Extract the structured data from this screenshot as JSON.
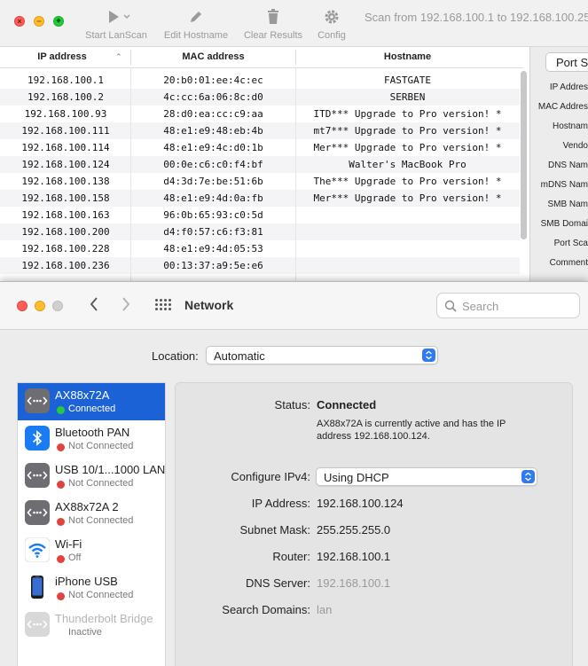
{
  "lanscan": {
    "toolbar": {
      "start_label": "Start LanScan",
      "edit_label": "Edit Hostname",
      "clear_label": "Clear Results",
      "config_label": "Config"
    },
    "title": "Scan from 192.168.100.1 to 192.168.100.25",
    "columns": {
      "ip": "IP address",
      "mac": "MAC address",
      "host": "Hostname"
    },
    "rows": [
      {
        "ip": "192.168.100.1",
        "mac": "20:b0:01:ee:4c:ec",
        "host": "FASTGATE"
      },
      {
        "ip": "192.168.100.2",
        "mac": "4c:cc:6a:06:8c:d0",
        "host": "SERBEN"
      },
      {
        "ip": "192.168.100.93",
        "mac": "28:d0:ea:cc:c9:aa",
        "host": "ITD*** Upgrade to Pro version! *"
      },
      {
        "ip": "192.168.100.111",
        "mac": "48:e1:e9:48:eb:4b",
        "host": "mt7*** Upgrade to Pro version! *"
      },
      {
        "ip": "192.168.100.114",
        "mac": "48:e1:e9:4c:d0:1b",
        "host": "Mer*** Upgrade to Pro version! *"
      },
      {
        "ip": "192.168.100.124",
        "mac": "00:0e:c6:c0:f4:bf",
        "host": "Walter's MacBook Pro"
      },
      {
        "ip": "192.168.100.138",
        "mac": "d4:3d:7e:be:51:6b",
        "host": "The*** Upgrade to Pro version! *"
      },
      {
        "ip": "192.168.100.158",
        "mac": "48:e1:e9:4d:0a:fb",
        "host": "Mer*** Upgrade to Pro version! *"
      },
      {
        "ip": "192.168.100.163",
        "mac": "96:0b:65:93:c0:5d",
        "host": ""
      },
      {
        "ip": "192.168.100.200",
        "mac": "d4:f0:57:c6:f3:81",
        "host": ""
      },
      {
        "ip": "192.168.100.228",
        "mac": "48:e1:e9:4d:05:53",
        "host": ""
      },
      {
        "ip": "192.168.100.236",
        "mac": "00:13:37:a9:5e:e6",
        "host": ""
      }
    ],
    "detail": {
      "port_button": "Port S",
      "labels": [
        "IP Addres",
        "MAC Addres",
        "Hostnam",
        "Vendo",
        "DNS Nam",
        "mDNS Nam",
        "SMB Nam",
        "SMB Domai",
        "Port Sca",
        "Comment"
      ]
    }
  },
  "network": {
    "title": "Network",
    "search": {
      "placeholder": "Search"
    },
    "location": {
      "label": "Location:",
      "value": "Automatic"
    },
    "services": [
      {
        "name": "AX88x72A",
        "status": "Connected",
        "status_color": "#28c840",
        "icon": "ethernet-icon"
      },
      {
        "name": "Bluetooth PAN",
        "status": "Not Connected",
        "status_color": "#e0443e",
        "icon": "bluetooth-icon"
      },
      {
        "name": "USB 10/1...1000 LAN",
        "status": "Not Connected",
        "status_color": "#e0443e",
        "icon": "ethernet-icon"
      },
      {
        "name": "AX88x72A 2",
        "status": "Not Connected",
        "status_color": "#e0443e",
        "icon": "ethernet-icon"
      },
      {
        "name": "Wi-Fi",
        "status": "Off",
        "status_color": "#e0443e",
        "icon": "wifi-icon"
      },
      {
        "name": "iPhone USB",
        "status": "Not Connected",
        "status_color": "#e0443e",
        "icon": "iphone-icon"
      },
      {
        "name": "Thunderbolt Bridge",
        "status": "Inactive",
        "status_color": "",
        "icon": "ethernet-icon"
      }
    ],
    "detail": {
      "status_label": "Status:",
      "status_value": "Connected",
      "status_desc": "AX88x72A is currently active and has the IP address 192.168.100.124.",
      "configure_label": "Configure IPv4:",
      "configure_value": "Using DHCP",
      "ip_label": "IP Address:",
      "ip_value": "192.168.100.124",
      "subnet_label": "Subnet Mask:",
      "subnet_value": "255.255.255.0",
      "router_label": "Router:",
      "router_value": "192.168.100.1",
      "dns_label": "DNS Server:",
      "dns_value": "192.168.100.1",
      "domains_label": "Search Domains:",
      "domains_value": "lan"
    }
  }
}
